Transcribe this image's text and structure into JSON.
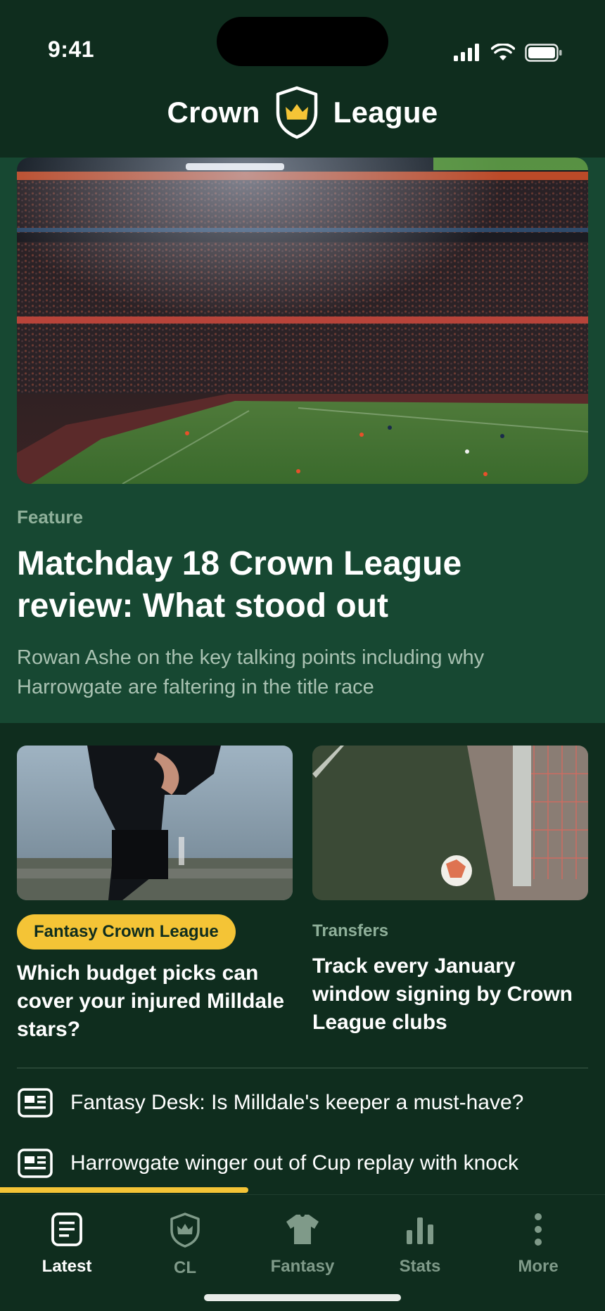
{
  "status_bar": {
    "time": "9:41"
  },
  "brand": {
    "word_left": "Crown",
    "word_right": "League"
  },
  "hero": {
    "kicker": "Feature",
    "title": "Matchday 18 Crown League review: What stood out",
    "dek": "Rowan Ashe on the key talking points including why Harrowgate are faltering in the title race"
  },
  "cards": [
    {
      "tag": "Fantasy Crown League",
      "title": "Which budget picks can cover your injured Milldale stars?"
    },
    {
      "kicker": "Transfers",
      "title": "Track every January window signing by Crown League clubs"
    }
  ],
  "headlines": [
    {
      "icon": "news-article-icon",
      "text": "Fantasy Desk: Is Milldale's keeper a must-have?"
    },
    {
      "icon": "news-article-icon",
      "text": "Harrowgate winger out of Cup replay with knock"
    }
  ],
  "scroll_progress": 0.41,
  "tabs": [
    {
      "label": "Latest",
      "icon": "document-icon",
      "active": true
    },
    {
      "label": "CL",
      "icon": "shield-icon",
      "active": false
    },
    {
      "label": "Fantasy",
      "icon": "jersey-icon",
      "active": false
    },
    {
      "label": "Stats",
      "icon": "bar-chart-icon",
      "active": false
    },
    {
      "label": "More",
      "icon": "more-vertical-icon",
      "active": false
    }
  ],
  "colors": {
    "header_bg": "#0f2d1e",
    "hero_bg": "#174832",
    "accent_yellow": "#f4c436",
    "kicker_green": "#8fb09a"
  }
}
